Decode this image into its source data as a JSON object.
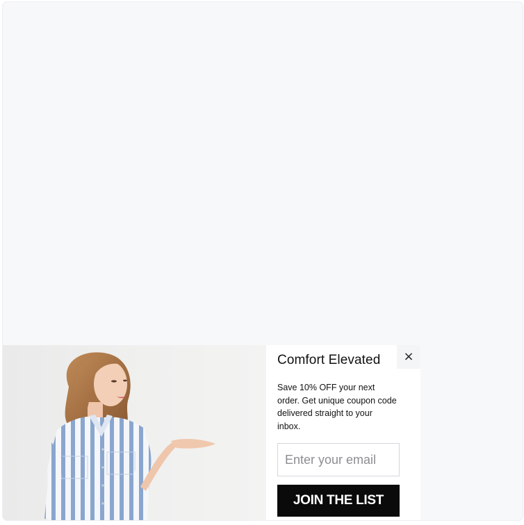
{
  "popup": {
    "title": "Comfort Elevated",
    "description": "Save 10% OFF your next order. Get unique coupon code delivered straight to your inbox.",
    "email_placeholder": "Enter your email",
    "email_value": "",
    "cta_label": "JOIN THE LIST",
    "close_symbol": "×",
    "close_icon": "close-icon",
    "image": "woman in blue striped shirt dress presenting open palm"
  },
  "colors": {
    "page_background": "#f7f8fa",
    "button_background": "#0a0a0a",
    "button_text": "#ffffff",
    "close_background": "#f4f5f7"
  }
}
